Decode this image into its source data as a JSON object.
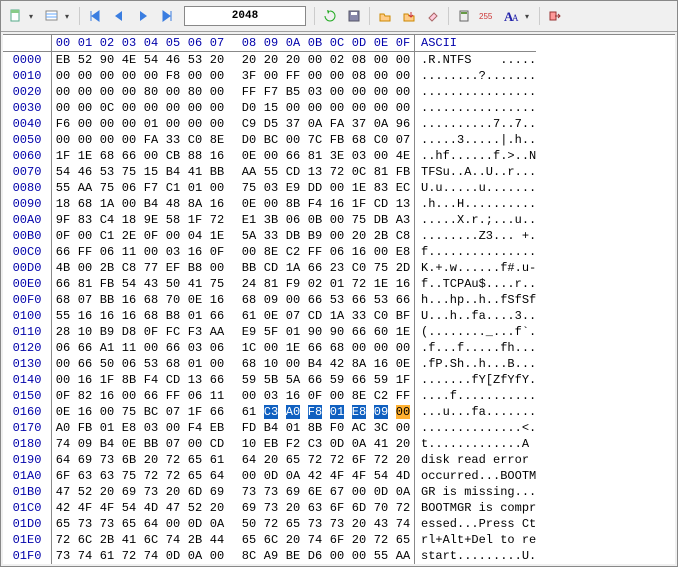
{
  "toolbar": {
    "address": "2048"
  },
  "header": {
    "cols": [
      "00",
      "01",
      "02",
      "03",
      "04",
      "05",
      "06",
      "07",
      "08",
      "09",
      "0A",
      "0B",
      "0C",
      "0D",
      "0E",
      "0F"
    ],
    "ascii_title": "ASCII"
  },
  "selection": {
    "row": "0160",
    "start": 9,
    "end": 14,
    "caret": 15
  },
  "rows": [
    {
      "o": "0000",
      "h": [
        "EB",
        "52",
        "90",
        "4E",
        "54",
        "46",
        "53",
        "20",
        "20",
        "20",
        "20",
        "00",
        "02",
        "08",
        "00",
        "00"
      ],
      "a": ".R.NTFS    ....."
    },
    {
      "o": "0010",
      "h": [
        "00",
        "00",
        "00",
        "00",
        "00",
        "F8",
        "00",
        "00",
        "3F",
        "00",
        "FF",
        "00",
        "00",
        "08",
        "00",
        "00"
      ],
      "a": "........?......."
    },
    {
      "o": "0020",
      "h": [
        "00",
        "00",
        "00",
        "00",
        "80",
        "00",
        "80",
        "00",
        "FF",
        "F7",
        "B5",
        "03",
        "00",
        "00",
        "00",
        "00"
      ],
      "a": "................"
    },
    {
      "o": "0030",
      "h": [
        "00",
        "00",
        "0C",
        "00",
        "00",
        "00",
        "00",
        "00",
        "D0",
        "15",
        "00",
        "00",
        "00",
        "00",
        "00",
        "00"
      ],
      "a": "................"
    },
    {
      "o": "0040",
      "h": [
        "F6",
        "00",
        "00",
        "00",
        "01",
        "00",
        "00",
        "00",
        "C9",
        "D5",
        "37",
        "0A",
        "FA",
        "37",
        "0A",
        "96"
      ],
      "a": "..........7..7.."
    },
    {
      "o": "0050",
      "h": [
        "00",
        "00",
        "00",
        "00",
        "FA",
        "33",
        "C0",
        "8E",
        "D0",
        "BC",
        "00",
        "7C",
        "FB",
        "68",
        "C0",
        "07"
      ],
      "a": ".....3.....|.h.."
    },
    {
      "o": "0060",
      "h": [
        "1F",
        "1E",
        "68",
        "66",
        "00",
        "CB",
        "88",
        "16",
        "0E",
        "00",
        "66",
        "81",
        "3E",
        "03",
        "00",
        "4E"
      ],
      "a": "..hf......f.>..N"
    },
    {
      "o": "0070",
      "h": [
        "54",
        "46",
        "53",
        "75",
        "15",
        "B4",
        "41",
        "BB",
        "AA",
        "55",
        "CD",
        "13",
        "72",
        "0C",
        "81",
        "FB"
      ],
      "a": "TFSu..A..U..r..."
    },
    {
      "o": "0080",
      "h": [
        "55",
        "AA",
        "75",
        "06",
        "F7",
        "C1",
        "01",
        "00",
        "75",
        "03",
        "E9",
        "DD",
        "00",
        "1E",
        "83",
        "EC"
      ],
      "a": "U.u.....u......."
    },
    {
      "o": "0090",
      "h": [
        "18",
        "68",
        "1A",
        "00",
        "B4",
        "48",
        "8A",
        "16",
        "0E",
        "00",
        "8B",
        "F4",
        "16",
        "1F",
        "CD",
        "13"
      ],
      "a": ".h...H.........."
    },
    {
      "o": "00A0",
      "h": [
        "9F",
        "83",
        "C4",
        "18",
        "9E",
        "58",
        "1F",
        "72",
        "E1",
        "3B",
        "06",
        "0B",
        "00",
        "75",
        "DB",
        "A3"
      ],
      "a": ".....X.r.;...u.."
    },
    {
      "o": "00B0",
      "h": [
        "0F",
        "00",
        "C1",
        "2E",
        "0F",
        "00",
        "04",
        "1E",
        "5A",
        "33",
        "DB",
        "B9",
        "00",
        "20",
        "2B",
        "C8"
      ],
      "a": "........Z3... +."
    },
    {
      "o": "00C0",
      "h": [
        "66",
        "FF",
        "06",
        "11",
        "00",
        "03",
        "16",
        "0F",
        "00",
        "8E",
        "C2",
        "FF",
        "06",
        "16",
        "00",
        "E8"
      ],
      "a": "f..............."
    },
    {
      "o": "00D0",
      "h": [
        "4B",
        "00",
        "2B",
        "C8",
        "77",
        "EF",
        "B8",
        "00",
        "BB",
        "CD",
        "1A",
        "66",
        "23",
        "C0",
        "75",
        "2D"
      ],
      "a": "K.+.w......f#.u-"
    },
    {
      "o": "00E0",
      "h": [
        "66",
        "81",
        "FB",
        "54",
        "43",
        "50",
        "41",
        "75",
        "24",
        "81",
        "F9",
        "02",
        "01",
        "72",
        "1E",
        "16"
      ],
      "a": "f..TCPAu$....r.."
    },
    {
      "o": "00F0",
      "h": [
        "68",
        "07",
        "BB",
        "16",
        "68",
        "70",
        "0E",
        "16",
        "68",
        "09",
        "00",
        "66",
        "53",
        "66",
        "53",
        "66"
      ],
      "a": "h...hp..h..fSfSf"
    },
    {
      "o": "0100",
      "h": [
        "55",
        "16",
        "16",
        "16",
        "68",
        "B8",
        "01",
        "66",
        "61",
        "0E",
        "07",
        "CD",
        "1A",
        "33",
        "C0",
        "BF"
      ],
      "a": "U...h..fa....3.."
    },
    {
      "o": "0110",
      "h": [
        "28",
        "10",
        "B9",
        "D8",
        "0F",
        "FC",
        "F3",
        "AA",
        "E9",
        "5F",
        "01",
        "90",
        "90",
        "66",
        "60",
        "1E"
      ],
      "a": "(........_...f`."
    },
    {
      "o": "0120",
      "h": [
        "06",
        "66",
        "A1",
        "11",
        "00",
        "66",
        "03",
        "06",
        "1C",
        "00",
        "1E",
        "66",
        "68",
        "00",
        "00",
        "00"
      ],
      "a": ".f...f.....fh..."
    },
    {
      "o": "0130",
      "h": [
        "00",
        "66",
        "50",
        "06",
        "53",
        "68",
        "01",
        "00",
        "68",
        "10",
        "00",
        "B4",
        "42",
        "8A",
        "16",
        "0E"
      ],
      "a": ".fP.Sh..h...B..."
    },
    {
      "o": "0140",
      "h": [
        "00",
        "16",
        "1F",
        "8B",
        "F4",
        "CD",
        "13",
        "66",
        "59",
        "5B",
        "5A",
        "66",
        "59",
        "66",
        "59",
        "1F"
      ],
      "a": ".......fY[ZfYfY."
    },
    {
      "o": "0150",
      "h": [
        "0F",
        "82",
        "16",
        "00",
        "66",
        "FF",
        "06",
        "11",
        "00",
        "03",
        "16",
        "0F",
        "00",
        "8E",
        "C2",
        "FF"
      ],
      "a": "....f..........."
    },
    {
      "o": "0160",
      "h": [
        "0E",
        "16",
        "00",
        "75",
        "BC",
        "07",
        "1F",
        "66",
        "61",
        "C3",
        "A0",
        "F8",
        "01",
        "E8",
        "09",
        "00"
      ],
      "a": "...u...fa......."
    },
    {
      "o": "0170",
      "h": [
        "A0",
        "FB",
        "01",
        "E8",
        "03",
        "00",
        "F4",
        "EB",
        "FD",
        "B4",
        "01",
        "8B",
        "F0",
        "AC",
        "3C",
        "00"
      ],
      "a": "..............<."
    },
    {
      "o": "0180",
      "h": [
        "74",
        "09",
        "B4",
        "0E",
        "BB",
        "07",
        "00",
        "CD",
        "10",
        "EB",
        "F2",
        "C3",
        "0D",
        "0A",
        "41",
        "20"
      ],
      "a": "t.............A "
    },
    {
      "o": "0190",
      "h": [
        "64",
        "69",
        "73",
        "6B",
        "20",
        "72",
        "65",
        "61",
        "64",
        "20",
        "65",
        "72",
        "72",
        "6F",
        "72",
        "20"
      ],
      "a": "disk read error "
    },
    {
      "o": "01A0",
      "h": [
        "6F",
        "63",
        "63",
        "75",
        "72",
        "72",
        "65",
        "64",
        "00",
        "0D",
        "0A",
        "42",
        "4F",
        "4F",
        "54",
        "4D"
      ],
      "a": "occurred...BOOTM"
    },
    {
      "o": "01B0",
      "h": [
        "47",
        "52",
        "20",
        "69",
        "73",
        "20",
        "6D",
        "69",
        "73",
        "73",
        "69",
        "6E",
        "67",
        "00",
        "0D",
        "0A"
      ],
      "a": "GR is missing..."
    },
    {
      "o": "01C0",
      "h": [
        "42",
        "4F",
        "4F",
        "54",
        "4D",
        "47",
        "52",
        "20",
        "69",
        "73",
        "20",
        "63",
        "6F",
        "6D",
        "70",
        "72"
      ],
      "a": "BOOTMGR is compr"
    },
    {
      "o": "01D0",
      "h": [
        "65",
        "73",
        "73",
        "65",
        "64",
        "00",
        "0D",
        "0A",
        "50",
        "72",
        "65",
        "73",
        "73",
        "20",
        "43",
        "74"
      ],
      "a": "essed...Press Ct"
    },
    {
      "o": "01E0",
      "h": [
        "72",
        "6C",
        "2B",
        "41",
        "6C",
        "74",
        "2B",
        "44",
        "65",
        "6C",
        "20",
        "74",
        "6F",
        "20",
        "72",
        "65"
      ],
      "a": "rl+Alt+Del to re"
    },
    {
      "o": "01F0",
      "h": [
        "73",
        "74",
        "61",
        "72",
        "74",
        "0D",
        "0A",
        "00",
        "8C",
        "A9",
        "BE",
        "D6",
        "00",
        "00",
        "55",
        "AA"
      ],
      "a": "start.........U."
    }
  ]
}
